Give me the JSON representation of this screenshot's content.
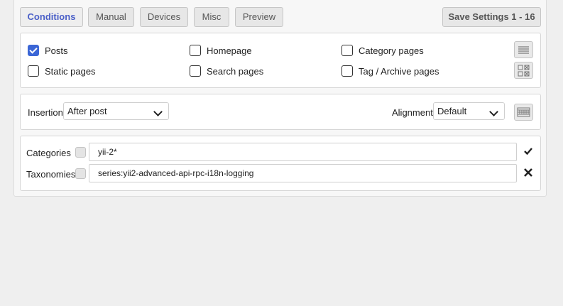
{
  "tabs": [
    {
      "label": "Conditions",
      "active": true
    },
    {
      "label": "Manual"
    },
    {
      "label": "Devices"
    },
    {
      "label": "Misc"
    },
    {
      "label": "Preview"
    }
  ],
  "save_button": "Save Settings 1 - 16",
  "page_types": {
    "posts": {
      "label": "Posts",
      "checked": true
    },
    "homepage": {
      "label": "Homepage",
      "checked": false
    },
    "category_pages": {
      "label": "Category pages",
      "checked": false
    },
    "static_pages": {
      "label": "Static pages",
      "checked": false
    },
    "search_pages": {
      "label": "Search pages",
      "checked": false
    },
    "tag_archive_pages": {
      "label": "Tag / Archive pages",
      "checked": false
    }
  },
  "insertion": {
    "label": "Insertion",
    "value": "After post"
  },
  "alignment": {
    "label": "Alignment",
    "value": "Default"
  },
  "filters": {
    "categories": {
      "label": "Categories",
      "value": "yii-2*",
      "status_icon": "check-icon"
    },
    "taxonomies": {
      "label": "Taxonomies",
      "value": "series:yii2-advanced-api-rpc-i18n-logging",
      "status_icon": "x-icon"
    }
  },
  "colors": {
    "accent": "#4b60c8",
    "checkbox": "#3b66d6"
  }
}
